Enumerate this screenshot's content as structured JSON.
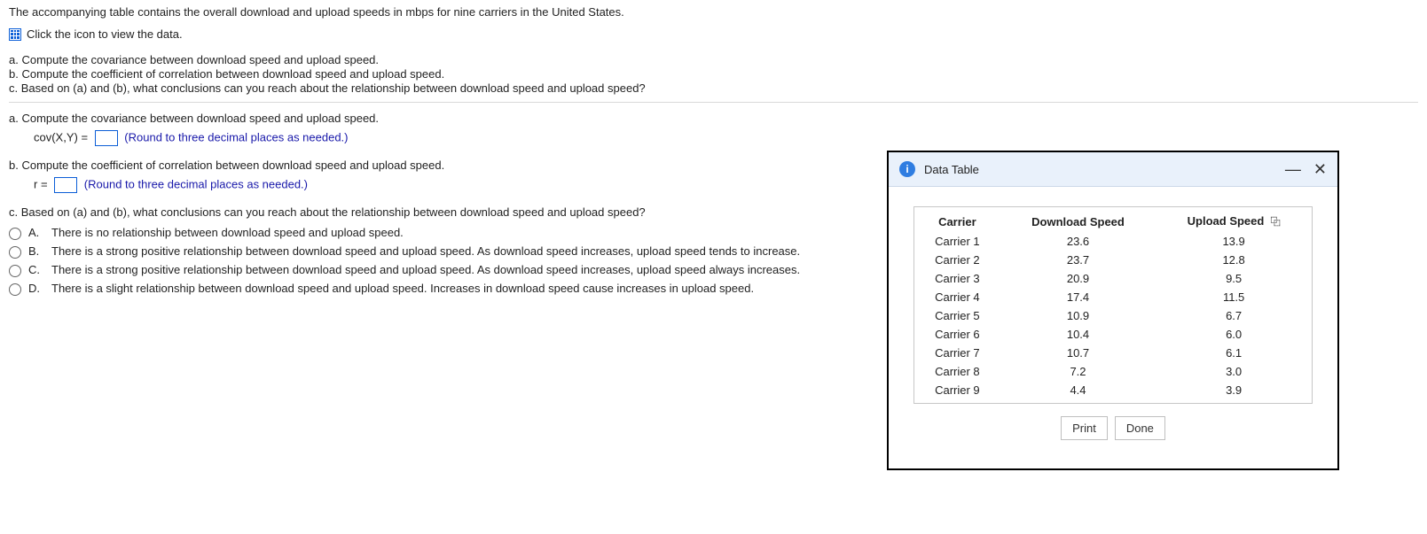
{
  "intro": "The accompanying table contains the overall download and upload speeds in mbps for nine carriers in the United States.",
  "view_data_text": "Click the icon to view the data.",
  "subparts": {
    "a": "a. Compute the covariance between download speed and upload speed.",
    "b": "b. Compute the coefficient of correlation between download speed and upload speed.",
    "c": "c. Based on (a) and (b), what conclusions can you reach about the relationship between download speed and upload speed?"
  },
  "partA": {
    "prompt": "a. Compute the covariance between download speed and upload speed.",
    "lhs": "cov(X,Y) =",
    "hint": "(Round to three decimal places as needed.)"
  },
  "partB": {
    "prompt": "b. Compute the coefficient of correlation between download speed and upload speed.",
    "lhs": "r =",
    "hint": "(Round to three decimal places as needed.)"
  },
  "partC": {
    "prompt": "c. Based on (a) and (b), what conclusions can you reach about the relationship between download speed and upload speed?",
    "options": [
      {
        "label": "A.",
        "text": "There is no relationship between download speed and upload speed."
      },
      {
        "label": "B.",
        "text": "There is a strong positive relationship between download speed and upload speed. As download speed increases, upload speed tends to increase."
      },
      {
        "label": "C.",
        "text": "There is a strong positive relationship between download speed and upload speed. As download speed increases, upload speed always increases."
      },
      {
        "label": "D.",
        "text": "There is a slight relationship between download speed and upload speed. Increases in download speed cause increases in upload speed."
      }
    ]
  },
  "dialog": {
    "title": "Data Table",
    "minimize": "—",
    "close": "✕",
    "info": "i",
    "copy_icon": "⿻",
    "buttons": {
      "print": "Print",
      "done": "Done"
    },
    "headers": [
      "Carrier",
      "Download Speed",
      "Upload Speed"
    ],
    "rows": [
      [
        "Carrier 1",
        "23.6",
        "13.9"
      ],
      [
        "Carrier 2",
        "23.7",
        "12.8"
      ],
      [
        "Carrier 3",
        "20.9",
        "9.5"
      ],
      [
        "Carrier 4",
        "17.4",
        "11.5"
      ],
      [
        "Carrier 5",
        "10.9",
        "6.7"
      ],
      [
        "Carrier 6",
        "10.4",
        "6.0"
      ],
      [
        "Carrier 7",
        "10.7",
        "6.1"
      ],
      [
        "Carrier 8",
        "7.2",
        "3.0"
      ],
      [
        "Carrier 9",
        "4.4",
        "3.9"
      ]
    ]
  },
  "chart_data": {
    "type": "table",
    "title": "Data Table",
    "columns": [
      "Carrier",
      "Download Speed",
      "Upload Speed"
    ],
    "rows": [
      [
        "Carrier 1",
        23.6,
        13.9
      ],
      [
        "Carrier 2",
        23.7,
        12.8
      ],
      [
        "Carrier 3",
        20.9,
        9.5
      ],
      [
        "Carrier 4",
        17.4,
        11.5
      ],
      [
        "Carrier 5",
        10.9,
        6.7
      ],
      [
        "Carrier 6",
        10.4,
        6.0
      ],
      [
        "Carrier 7",
        10.7,
        6.1
      ],
      [
        "Carrier 8",
        7.2,
        3.0
      ],
      [
        "Carrier 9",
        4.4,
        3.9
      ]
    ]
  }
}
